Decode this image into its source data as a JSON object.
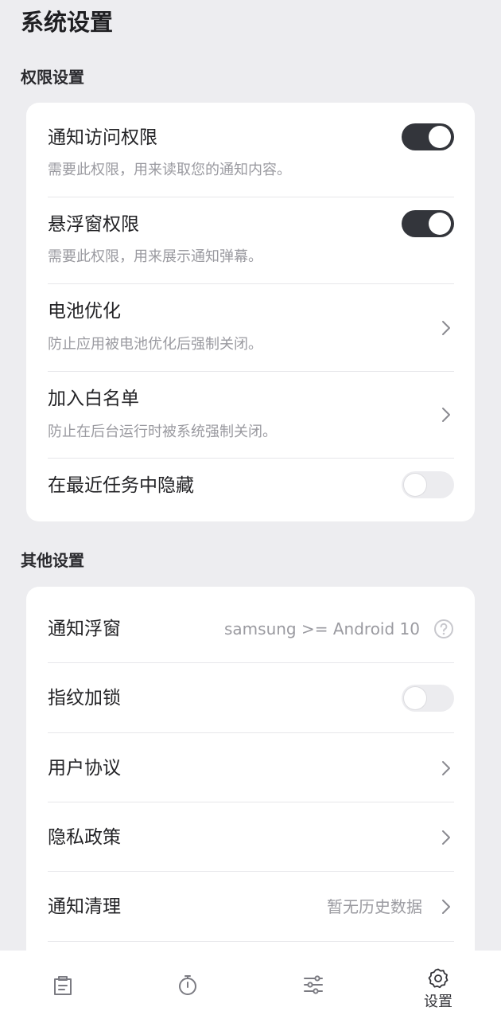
{
  "page": {
    "title": "系统设置"
  },
  "permissions": {
    "section_title": "权限设置",
    "items": [
      {
        "title": "通知访问权限",
        "desc": "需要此权限，用来读取您的通知内容。",
        "control": "toggle",
        "on": true
      },
      {
        "title": "悬浮窗权限",
        "desc": "需要此权限，用来展示通知弹幕。",
        "control": "toggle",
        "on": true
      },
      {
        "title": "电池优化",
        "desc": "防止应用被电池优化后强制关闭。",
        "control": "chevron"
      },
      {
        "title": "加入白名单",
        "desc": "防止在后台运行时被系统强制关闭。",
        "control": "chevron"
      },
      {
        "title": "在最近任务中隐藏",
        "control": "toggle",
        "on": false
      }
    ]
  },
  "other": {
    "section_title": "其他设置",
    "items": [
      {
        "title": "通知浮窗",
        "value": "samsung >= Android 10",
        "control": "help-icon"
      },
      {
        "title": "指纹加锁",
        "control": "toggle",
        "on": false
      },
      {
        "title": "用户协议",
        "control": "chevron"
      },
      {
        "title": "隐私政策",
        "control": "chevron"
      },
      {
        "title": "通知清理",
        "value": "暂无历史数据",
        "control": "chevron"
      }
    ]
  },
  "bottom_nav": {
    "items": [
      {
        "icon": "clipboard-icon",
        "label": ""
      },
      {
        "icon": "stopwatch-icon",
        "label": ""
      },
      {
        "icon": "sliders-icon",
        "label": ""
      },
      {
        "icon": "gear-icon",
        "label": "设置",
        "active": true
      }
    ]
  },
  "colors": {
    "background": "#ededf0",
    "card": "#ffffff",
    "toggle_on": "#33353b",
    "toggle_off": "#ececef",
    "secondary_text": "#9a9aa0"
  }
}
